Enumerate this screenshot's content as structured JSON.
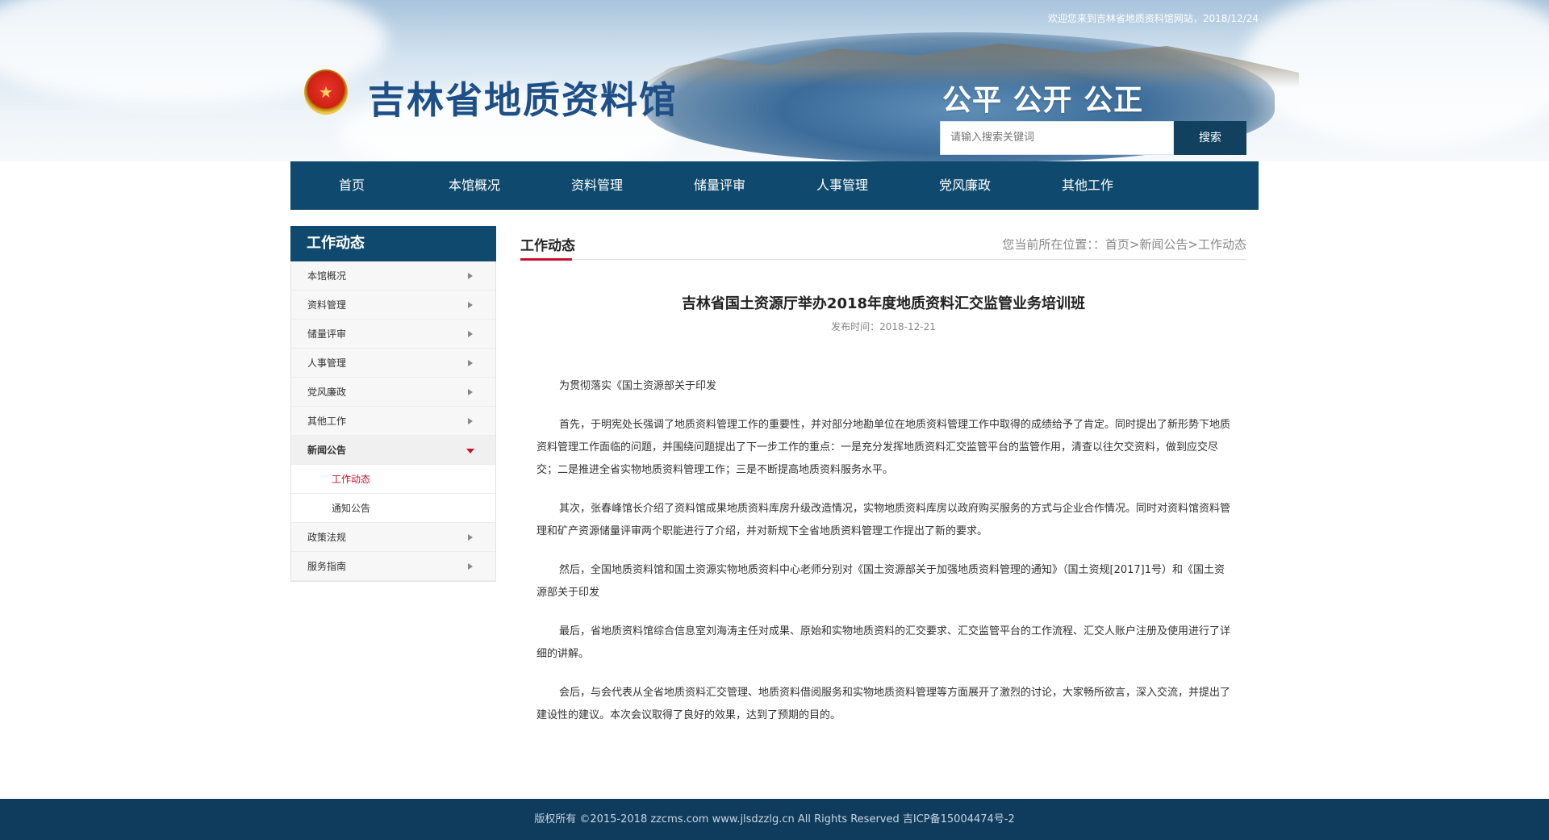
{
  "header": {
    "welcome": "欢迎您来到吉林省地质资料馆网站，2018/12/24",
    "site_title": "吉林省地质资料馆",
    "slogan": "公平 公开 公正",
    "search_placeholder": "请输入搜索关键词",
    "search_button": "搜索"
  },
  "nav": {
    "items": [
      "首页",
      "本馆概况",
      "资料管理",
      "储量评审",
      "人事管理",
      "党风廉政",
      "其他工作"
    ]
  },
  "sidebar": {
    "title": "工作动态",
    "items": [
      "本馆概况",
      "资料管理",
      "储量评审",
      "人事管理",
      "党风廉政",
      "其他工作",
      "新闻公告"
    ],
    "sub_items": [
      "工作动态",
      "通知公告"
    ],
    "more_items": [
      "政策法规",
      "服务指南"
    ]
  },
  "content": {
    "section_title": "工作动态",
    "location": "您当前所在位置：：首页>新闻公告>工作动态",
    "article_title": "吉林省国土资源厅举办2018年度地质资料汇交监管业务培训班",
    "article_date": "发布时间：2018-12-21",
    "paragraphs": [
      "为贯彻落实《国土资源部关于印发",
      "首先，于明宪处长强调了地质资料管理工作的重要性，并对部分地勘单位在地质资料管理工作中取得的成绩给予了肯定。同时提出了新形势下地质资料管理工作面临的问题，并围绕问题提出了下一步工作的重点：一是充分发挥地质资料汇交监管平台的监管作用，清查以往欠交资料，做到应交尽交；二是推进全省实物地质资料管理工作；三是不断提高地质资料服务水平。",
      "其次，张春峰馆长介绍了资料馆成果地质资料库房升级改造情况，实物地质资料库房以政府购买服务的方式与企业合作情况。同时对资料馆资料管理和矿产资源储量评审两个职能进行了介绍，并对新规下全省地质资料管理工作提出了新的要求。",
      "然后，全国地质资料馆和国土资源实物地质资料中心老师分别对《国土资源部关于加强地质资料管理的通知》（国土资规[2017]1号）和《国土资源部关于印发",
      "最后，省地质资料馆综合信息室刘海涛主任对成果、原始和实物地质资料的汇交要求、汇交监管平台的工作流程、汇交人账户注册及使用进行了详细的讲解。",
      "会后，与会代表从全省地质资料汇交管理、地质资料借阅服务和实物地质资料管理等方面展开了激烈的讨论，大家畅所欲言，深入交流，并提出了建设性的建议。本次会议取得了良好的效果，达到了预期的目的。"
    ]
  },
  "footer": {
    "text": "版权所有 ©2015-2018 zzcms.com www.jlsdzzlg.cn All Rights Reserved 吉ICP备15004474号-2"
  },
  "colors": {
    "nav_bg": "#0f4a6e",
    "accent_red": "#c5142b",
    "footer_bg": "#0f3b5c",
    "title_blue": "#1e4f86"
  }
}
